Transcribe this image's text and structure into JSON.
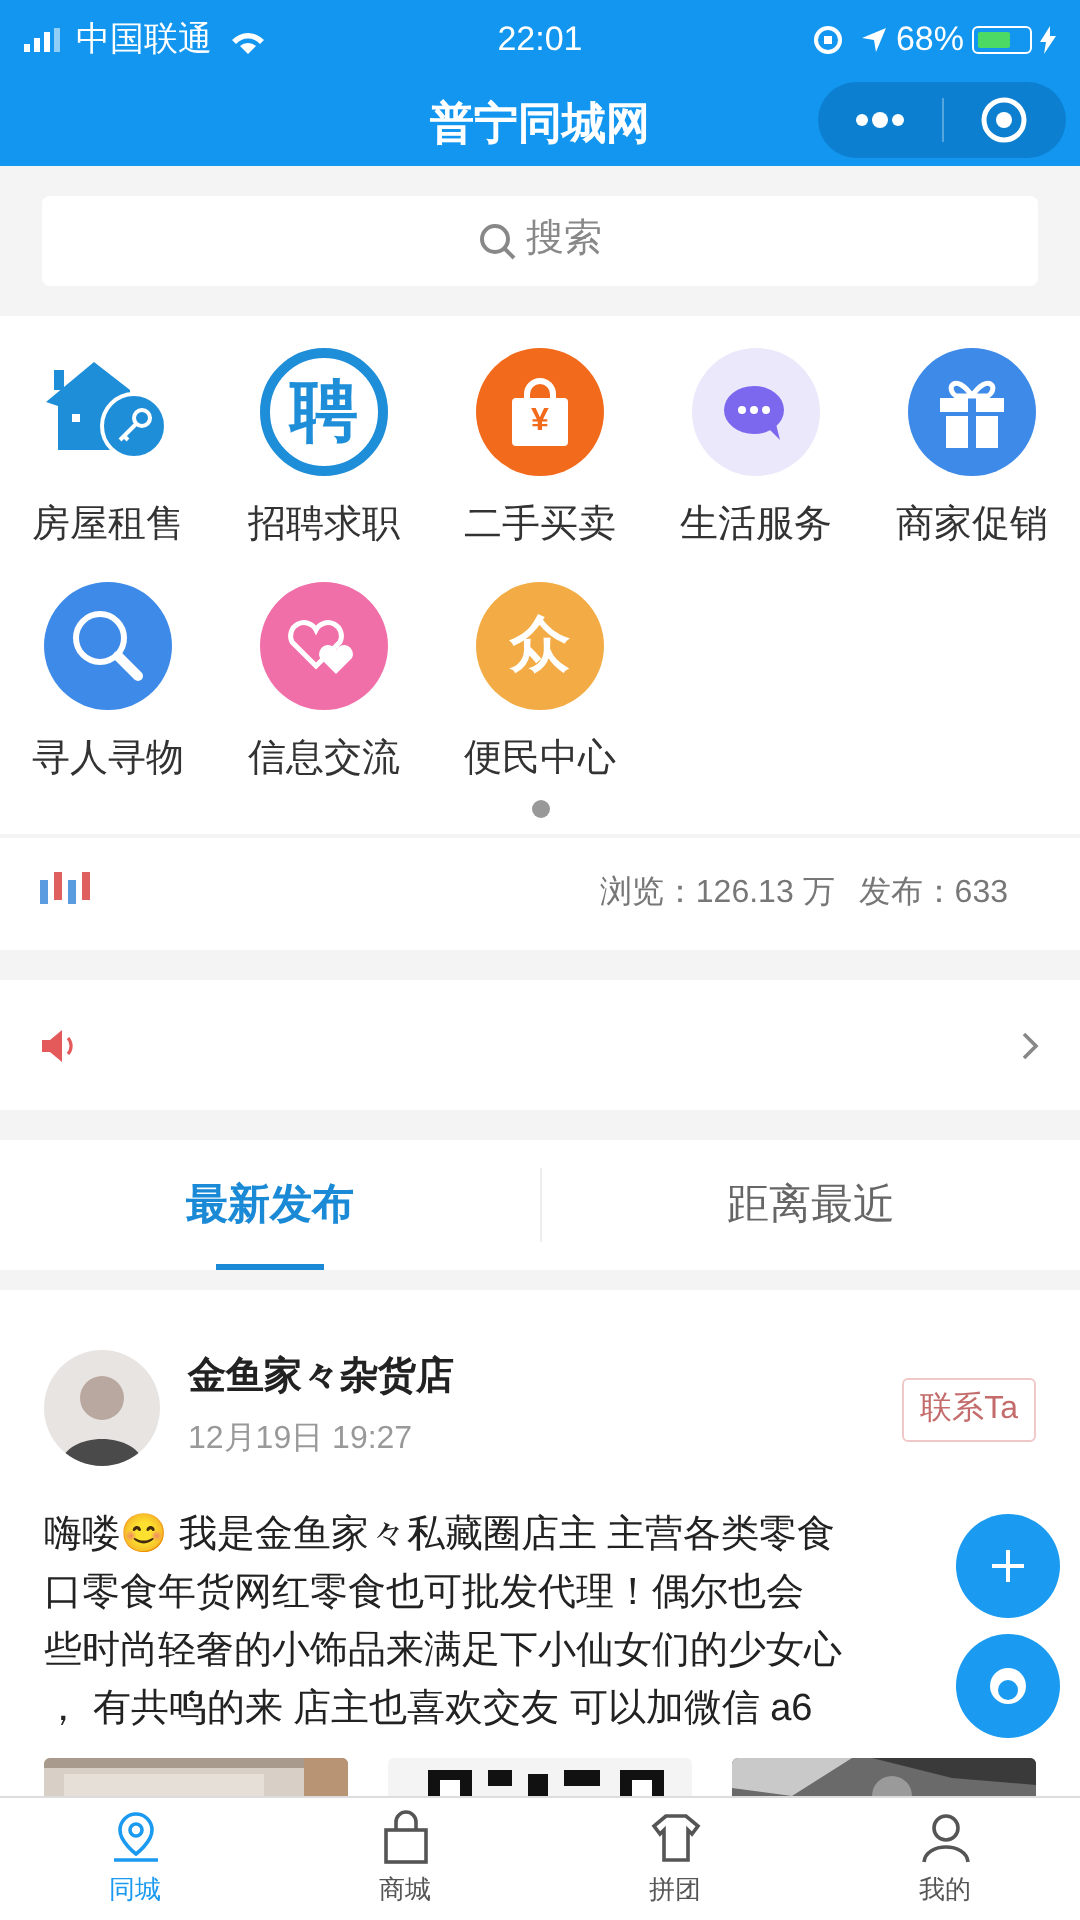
{
  "status_bar": {
    "carrier": "中国联通",
    "time": "22:01",
    "battery_text": "68%",
    "battery": {
      "level": 0.68
    }
  },
  "nav": {
    "title": "普宁同城网"
  },
  "search": {
    "placeholder": "搜索"
  },
  "categories": [
    {
      "label": "房屋租售",
      "kind": "house"
    },
    {
      "label": "招聘求职",
      "kind": "hire",
      "glyph": "聘"
    },
    {
      "label": "二手买卖",
      "kind": "bag",
      "glyph": "¥"
    },
    {
      "label": "生活服务",
      "kind": "chat"
    },
    {
      "label": "商家促销",
      "kind": "gift"
    },
    {
      "label": "寻人寻物",
      "kind": "search"
    },
    {
      "label": "信息交流",
      "kind": "hearts"
    },
    {
      "label": "便民中心",
      "kind": "people",
      "glyph": "众"
    }
  ],
  "pager": [
    {
      "selected": true
    }
  ],
  "stats": {
    "views": "浏览：126.13 万",
    "posts": "发布：633"
  },
  "tabs": [
    {
      "label": "最新发布",
      "selected": true
    },
    {
      "label": "距离最近",
      "selected": false
    }
  ],
  "post": {
    "author": "金鱼家々杂货店",
    "time": "12月19日 19:27",
    "contact": "联系Ta",
    "body_lines": [
      "嗨喽😊 我是金鱼家々私藏圈店主 主营各类零食",
      "口零食年货网红零食也可批发代理！偶尔也会",
      "些时尚轻奢的小饰品来满足下小仙女们的少女心",
      "， 有共鸣的来 店主也喜欢交友 可以加微信 a6"
    ]
  },
  "bottom_tabs": [
    {
      "label": "同城",
      "kind": "pin",
      "selected": true
    },
    {
      "label": "商城",
      "kind": "bag",
      "selected": false
    },
    {
      "label": "拼团",
      "kind": "shirt",
      "selected": false
    },
    {
      "label": "我的",
      "kind": "person",
      "selected": false
    }
  ]
}
